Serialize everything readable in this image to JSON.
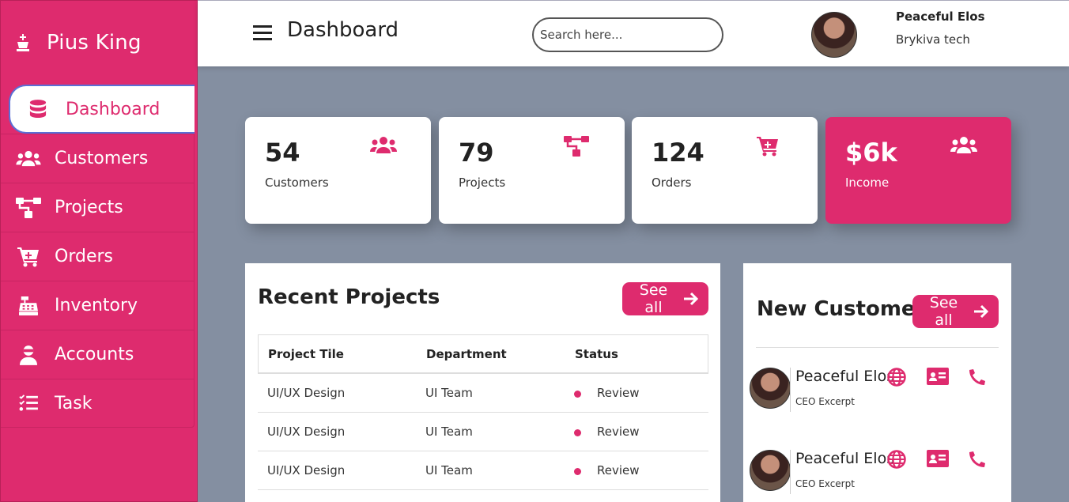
{
  "brand": {
    "name": "Pius King",
    "icon": "chess-king-icon"
  },
  "sidebar": {
    "items": [
      {
        "label": "Dashboard",
        "icon": "database-icon",
        "active": true
      },
      {
        "label": "Customers",
        "icon": "users-icon"
      },
      {
        "label": "Projects",
        "icon": "sitemap-icon"
      },
      {
        "label": "Orders",
        "icon": "cart-plus-icon"
      },
      {
        "label": "Inventory",
        "icon": "cash-register-icon"
      },
      {
        "label": "Accounts",
        "icon": "user-secret-icon"
      },
      {
        "label": "Task",
        "icon": "tasks-icon"
      }
    ]
  },
  "header": {
    "title": "Dashboard",
    "search_placeholder": "Search here...",
    "user": {
      "name": "Peaceful Elos",
      "org": "Brykiva tech"
    }
  },
  "cards": [
    {
      "value": "54",
      "label": "Customers",
      "icon": "users-icon"
    },
    {
      "value": "79",
      "label": "Projects",
      "icon": "sitemap-icon"
    },
    {
      "value": "124",
      "label": "Orders",
      "icon": "cart-plus-icon"
    },
    {
      "value": "$6k",
      "label": "Income",
      "icon": "users-icon"
    }
  ],
  "recent_projects": {
    "title": "Recent Projects",
    "see_all": "See all",
    "columns": [
      "Project Tile",
      "Department",
      "Status"
    ],
    "rows": [
      [
        "UI/UX Design",
        "UI Team",
        "Review"
      ],
      [
        "UI/UX Design",
        "UI Team",
        "Review"
      ],
      [
        "UI/UX Design",
        "UI Team",
        "Review"
      ]
    ]
  },
  "new_customer": {
    "title": "New Customer",
    "see_all": "See all",
    "items": [
      {
        "name": "Peaceful Elos",
        "role": "CEO Excerpt"
      },
      {
        "name": "Peaceful Elos",
        "role": "CEO Excerpt"
      }
    ]
  },
  "colors": {
    "accent": "#de2b6e",
    "background": "#848fa1"
  }
}
